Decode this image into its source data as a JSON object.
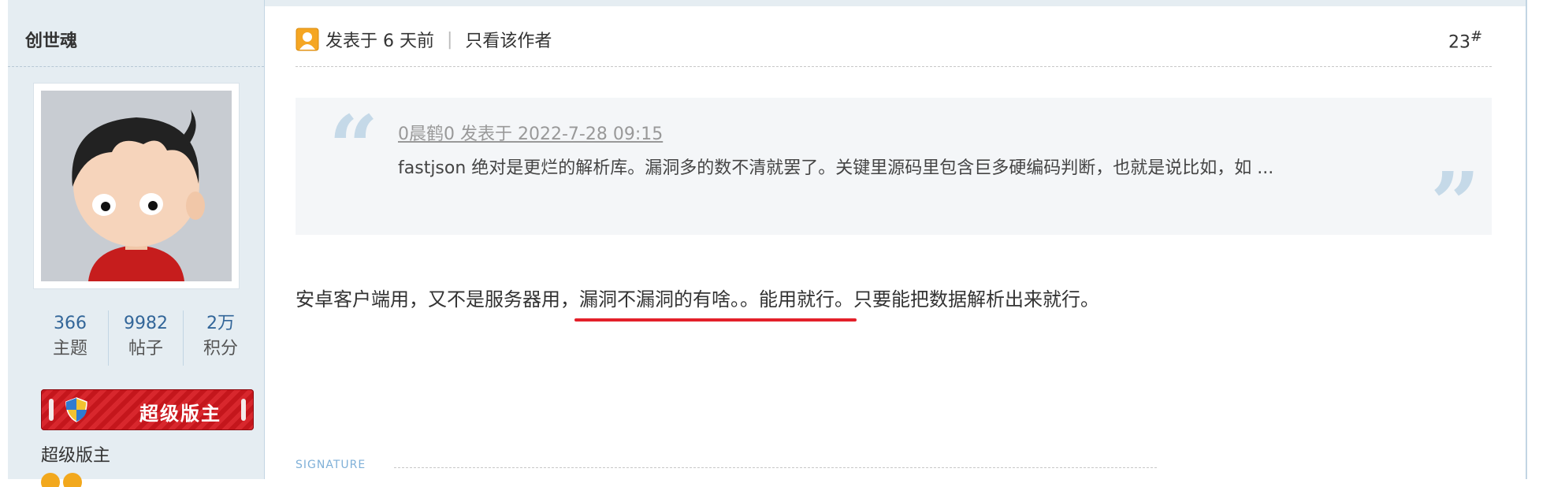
{
  "user": {
    "name": "创世魂",
    "stats": [
      {
        "value": "366",
        "label": "主题"
      },
      {
        "value": "9982",
        "label": "帖子"
      },
      {
        "value": "2万",
        "label": "积分"
      }
    ],
    "badge_text": "超级版主",
    "rank": "超级版主"
  },
  "post": {
    "posted": "发表于 6 天前",
    "separator": "|",
    "author_only": "只看该作者",
    "floor": "23",
    "floor_mark": "#",
    "quote": {
      "author_line": "0晨鹤0 发表于 2022-7-28 09:15",
      "text": "fastjson 绝对是更烂的解析库。漏洞多的数不清就罢了。关键里源码里包含巨多硬编码判断，也就是说比如，如 ..."
    },
    "body_before": "安卓客户端用，又不是服务器用，",
    "body_highlight": "漏洞不漏洞的有啥。。能用就行。",
    "body_after": "只要能把数据解析出来就行。",
    "signature_label": "SIGNATURE"
  },
  "colors": {
    "sidebar_bg": "#e5edf2",
    "stat_number": "#336699",
    "badge_red": "#c4161c",
    "highlight_underline": "#e3202a",
    "quote_mark": "#c5d9e8"
  }
}
